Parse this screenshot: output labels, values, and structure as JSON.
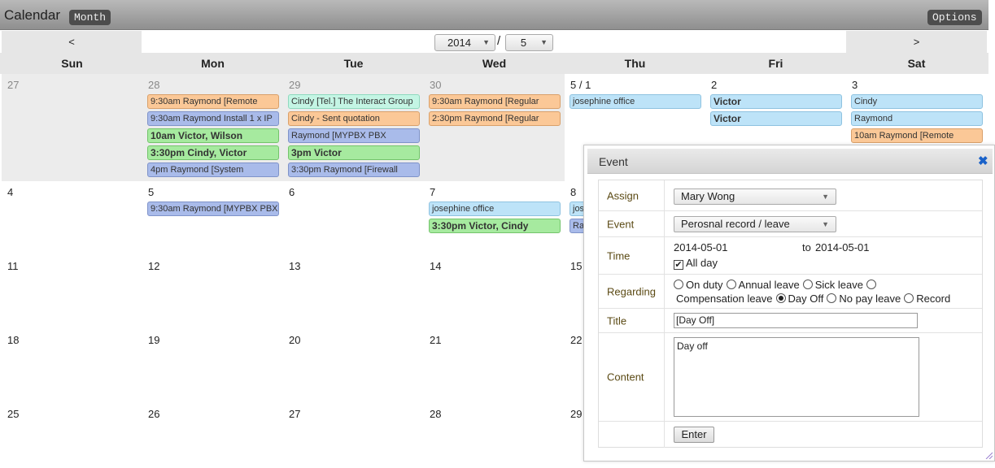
{
  "header": {
    "title": "Calendar",
    "view_button": "Month",
    "options_button": "Options"
  },
  "nav": {
    "prev_label": "<",
    "next_label": ">",
    "year": "2014",
    "separator": "/",
    "month": "5"
  },
  "weekdays": [
    "Sun",
    "Mon",
    "Tue",
    "Wed",
    "Thu",
    "Fri",
    "Sat"
  ],
  "weeks": [
    {
      "days": [
        {
          "label": "27",
          "events": []
        },
        {
          "label": "28",
          "events": [
            {
              "text": "9:30am Raymond [Remote",
              "color": "#fbc897"
            },
            {
              "text": "9:30am Raymond Install 1 x IP",
              "color": "#a9bbea"
            },
            {
              "text": "10am Victor, Wilson",
              "color": "#a6ea9f"
            },
            {
              "text": "3:30pm Cindy, Victor",
              "color": "#a6ea9f"
            },
            {
              "text": "4pm Raymond [System",
              "color": "#a9bbea"
            }
          ]
        },
        {
          "label": "29",
          "events": [
            {
              "text": "Cindy [Tel.] The Interact Group",
              "color": "#c4f5e4"
            },
            {
              "text": "Cindy - Sent quotation",
              "color": "#fbc897"
            },
            {
              "text": "Raymond [MYPBX PBX",
              "color": "#a9bbea"
            },
            {
              "text": "3pm Victor",
              "color": "#a6ea9f"
            },
            {
              "text": "3:30pm Raymond [Firewall",
              "color": "#a9bbea"
            }
          ]
        },
        {
          "label": "30",
          "events": [
            {
              "text": "9:30am Raymond [Regular",
              "color": "#fbc897"
            },
            {
              "text": "2:30pm Raymond [Regular",
              "color": "#fbc897"
            }
          ]
        },
        {
          "label": "5 / 1",
          "events": [
            {
              "text": "josephine office",
              "color": "#bde3f8"
            }
          ]
        },
        {
          "label": "2",
          "events": [
            {
              "text": "Victor",
              "color": "#bde3f8"
            },
            {
              "text": "Victor",
              "color": "#bde3f8"
            }
          ]
        },
        {
          "label": "3",
          "events": [
            {
              "text": "Cindy",
              "color": "#bde3f8"
            },
            {
              "text": "Raymond",
              "color": "#bde3f8"
            },
            {
              "text": "10am Raymond [Remote",
              "color": "#fbc897"
            }
          ]
        }
      ]
    },
    {
      "days": [
        {
          "label": "4",
          "events": []
        },
        {
          "label": "5",
          "events": [
            {
              "text": "9:30am Raymond [MYPBX PBX",
              "color": "#a9bbea"
            }
          ]
        },
        {
          "label": "6",
          "events": []
        },
        {
          "label": "7",
          "events": [
            {
              "text": "josephine office",
              "color": "#bde3f8"
            },
            {
              "text": "3:30pm Victor, Cindy",
              "color": "#a6ea9f"
            }
          ]
        },
        {
          "label": "8",
          "events": [
            {
              "text": "jos",
              "color": "#bde3f8"
            },
            {
              "text": "Ray",
              "color": "#a9bbea"
            }
          ]
        },
        {
          "label": "",
          "events": []
        },
        {
          "label": "",
          "events": []
        }
      ]
    },
    {
      "days": [
        {
          "label": "11",
          "events": []
        },
        {
          "label": "12",
          "events": []
        },
        {
          "label": "13",
          "events": []
        },
        {
          "label": "14",
          "events": []
        },
        {
          "label": "15",
          "events": []
        },
        {
          "label": "",
          "events": []
        },
        {
          "label": "",
          "events": []
        }
      ]
    },
    {
      "days": [
        {
          "label": "18",
          "events": []
        },
        {
          "label": "19",
          "events": []
        },
        {
          "label": "20",
          "events": []
        },
        {
          "label": "21",
          "events": []
        },
        {
          "label": "22",
          "events": []
        },
        {
          "label": "",
          "events": []
        },
        {
          "label": "",
          "events": []
        }
      ]
    },
    {
      "days": [
        {
          "label": "25",
          "events": []
        },
        {
          "label": "26",
          "events": []
        },
        {
          "label": "27",
          "events": []
        },
        {
          "label": "28",
          "events": []
        },
        {
          "label": "29",
          "events": []
        },
        {
          "label": "",
          "events": []
        },
        {
          "label": "",
          "events": []
        }
      ]
    }
  ],
  "dialog": {
    "title": "Event",
    "close_icon": "close-icon",
    "assign_label": "Assign",
    "assign_value": "Mary Wong",
    "event_label": "Event",
    "event_value": "Perosnal record / leave",
    "time_label": "Time",
    "time_from": "2014-05-01",
    "time_to_prefix": "to",
    "time_to": "2014-05-01",
    "all_day_label": "All day",
    "all_day_checked": true,
    "regarding_label": "Regarding",
    "regarding_options": [
      {
        "label": "On duty",
        "selected": false
      },
      {
        "label": "Annual leave",
        "selected": false
      },
      {
        "label": "Sick leave",
        "selected": false
      },
      {
        "label": "Compensation leave",
        "selected": false
      },
      {
        "label": "Day Off",
        "selected": true
      },
      {
        "label": "No pay leave",
        "selected": false
      },
      {
        "label": "Record",
        "selected": false
      }
    ],
    "title_label": "Title",
    "title_value": "[Day Off]",
    "content_label": "Content",
    "content_value": "Day off",
    "enter_button": "Enter"
  }
}
